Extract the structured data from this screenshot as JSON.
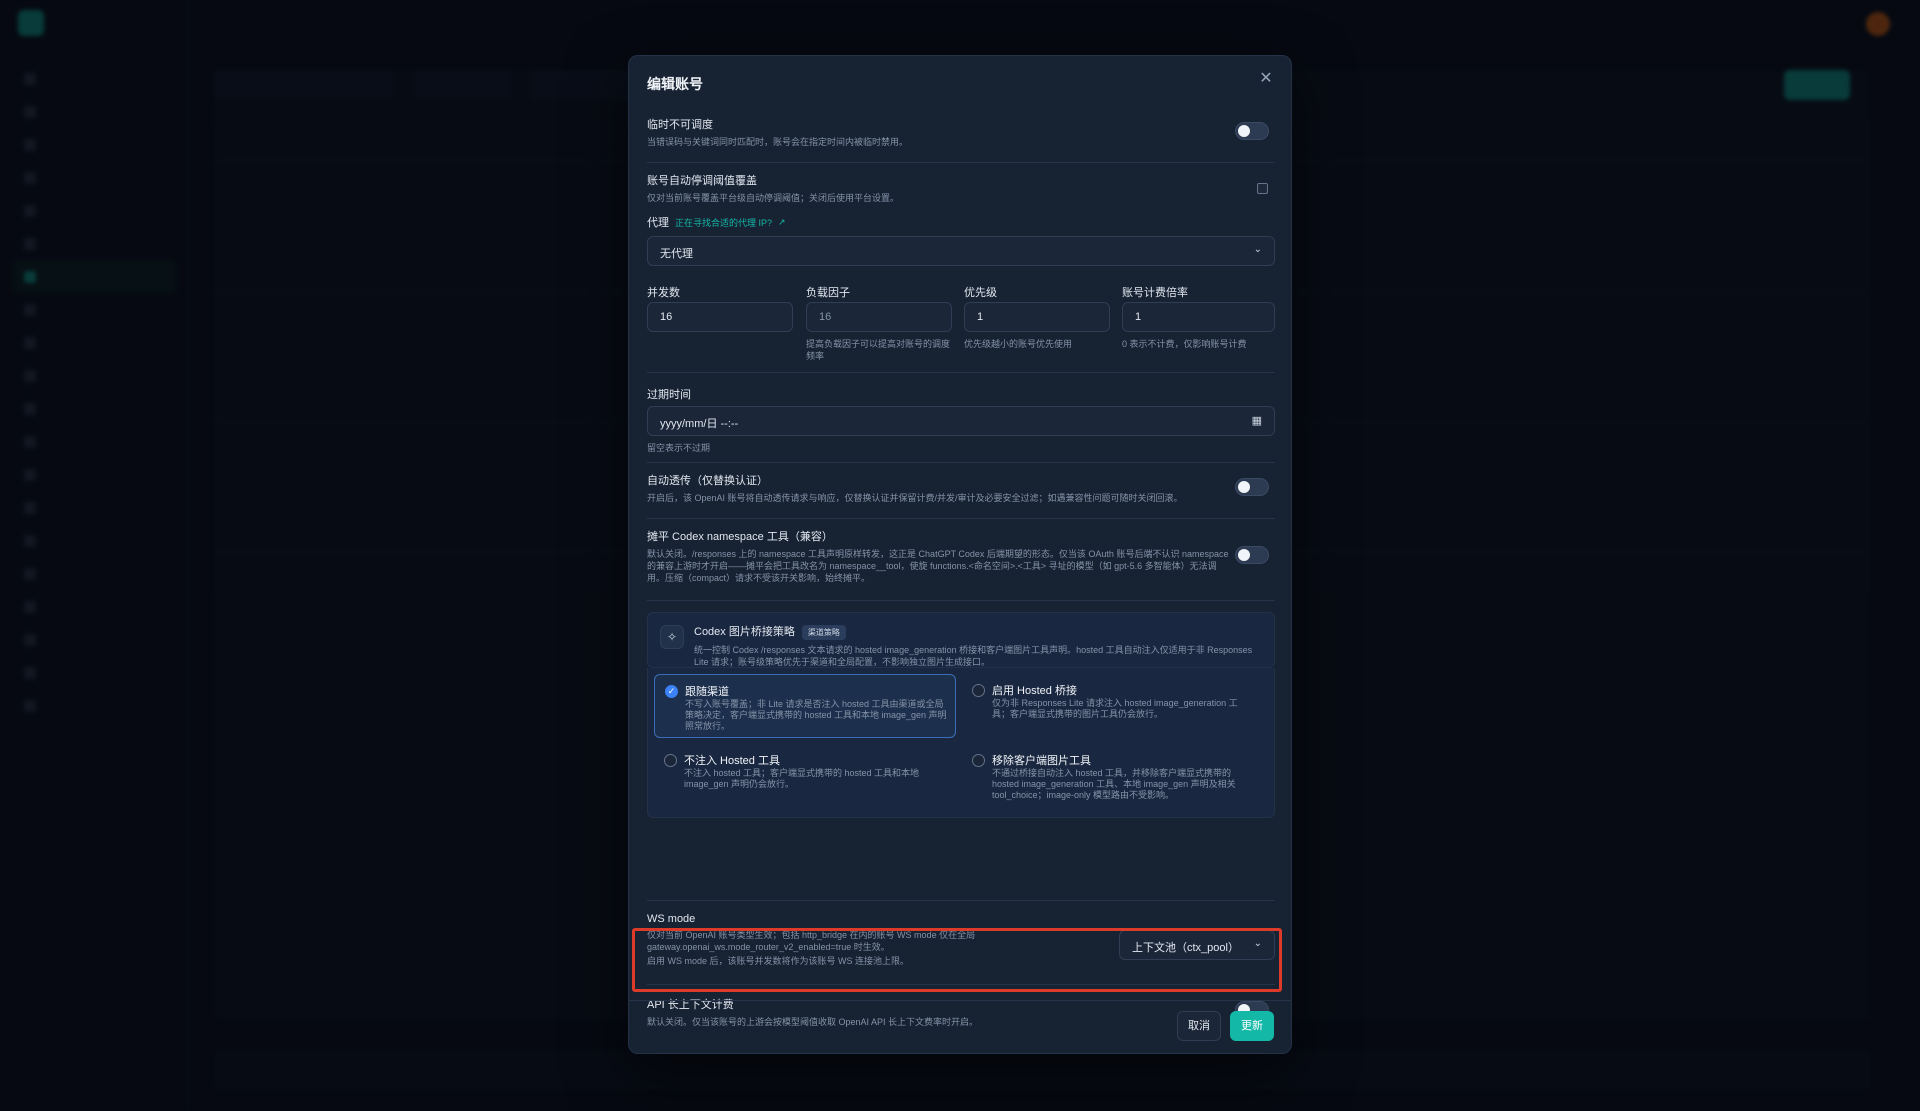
{
  "modal": {
    "title": "编辑账号",
    "temp_unschedulable": {
      "label": "临时不可调度",
      "hint": "当错误码与关键词同时匹配时，账号会在指定时间内被临时禁用。"
    },
    "auto_pause_override": {
      "label": "账号自动停调阈值覆盖",
      "hint": "仅对当前账号覆盖平台级自动停调阈值；关闭后使用平台设置。"
    },
    "proxy": {
      "label": "代理",
      "link": "正在寻找合适的代理 IP?",
      "value": "无代理"
    },
    "concurrency": {
      "label": "并发数",
      "value": "16"
    },
    "load_factor": {
      "label": "负载因子",
      "placeholder": "16",
      "hint": "提高负载因子可以提高对账号的调度频率"
    },
    "priority": {
      "label": "优先级",
      "value": "1",
      "hint": "优先级越小的账号优先使用"
    },
    "billing_rate": {
      "label": "账号计费倍率",
      "value": "1",
      "hint": "0 表示不计费，仅影响账号计费"
    },
    "expiry": {
      "label": "过期时间",
      "placeholder": "yyyy/mm/日 --:--",
      "hint": "留空表示不过期"
    },
    "auto_passthrough": {
      "label": "自动透传（仅替换认证）",
      "hint": "开启后，该 OpenAI 账号将自动透传请求与响应，仅替换认证并保留计费/并发/审计及必要安全过滤；如遇兼容性问题可随时关闭回滚。"
    },
    "codex_namespace": {
      "label": "摊平 Codex namespace 工具（兼容）",
      "hint": "默认关闭。/responses 上的 namespace 工具声明原样转发，这正是 ChatGPT Codex 后端期望的形态。仅当该 OAuth 账号后端不认识 namespace 的兼容上游时才开启——摊平会把工具改名为 namespace__tool，使旋 functions.<命名空间>.<工具> 寻址的模型（如 gpt-5.6 多智能体）无法调用。压缩（compact）请求不受该开关影响，始终摊平。"
    },
    "image_bridge": {
      "title": "Codex 图片桥接策略",
      "badge": "渠道策略",
      "desc": "统一控制 Codex /responses 文本请求的 hosted image_generation 桥接和客户端图片工具声明。hosted 工具自动注入仅适用于非 Responses Lite 请求；账号级策略优先于渠道和全局配置，不影响独立图片生成接口。",
      "options": [
        {
          "title": "跟随渠道",
          "desc": "不写入账号覆盖；非 Lite 请求是否注入 hosted 工具由渠道或全局策略决定，客户端显式携带的 hosted 工具和本地 image_gen 声明照常放行。",
          "checked": true
        },
        {
          "title": "启用 Hosted 桥接",
          "desc": "仅为非 Responses Lite 请求注入 hosted image_generation 工具；客户端显式携带的图片工具仍会放行。",
          "checked": false
        },
        {
          "title": "不注入 Hosted 工具",
          "desc": "不注入 hosted 工具；客户端显式携带的 hosted 工具和本地 image_gen 声明仍会放行。",
          "checked": false
        },
        {
          "title": "移除客户端图片工具",
          "desc": "不通过桥接自动注入 hosted 工具，并移除客户端显式携带的 hosted image_generation 工具、本地 image_gen 声明及相关 tool_choice；image-only 模型路由不受影响。",
          "checked": false
        }
      ]
    },
    "ws_mode": {
      "label": "WS mode",
      "hint1": "仅对当前 OpenAI 账号类型生效；包括 http_bridge 在内的账号 WS mode 仅在全局 gateway.openai_ws.mode_router_v2_enabled=true 时生效。",
      "hint2": "启用 WS mode 后，该账号并发数将作为该账号 WS 连接池上限。",
      "value": "上下文池（ctx_pool）"
    },
    "api_long_context": {
      "label": "API 长上下文计费",
      "hint": "默认关闭。仅当该账号的上游会按模型阈值收取 OpenAI API 长上下文费率时开启。"
    },
    "cancel_label": "取消",
    "update_label": "更新"
  },
  "colors": {
    "accent": "#14b8a6",
    "highlight_border": "#dc3b2a",
    "selected_option": "#3b82f6"
  },
  "icons": [
    "close-icon",
    "chevron-down-icon",
    "calendar-icon",
    "external-link-icon",
    "sparkle-icon",
    "check-icon"
  ]
}
